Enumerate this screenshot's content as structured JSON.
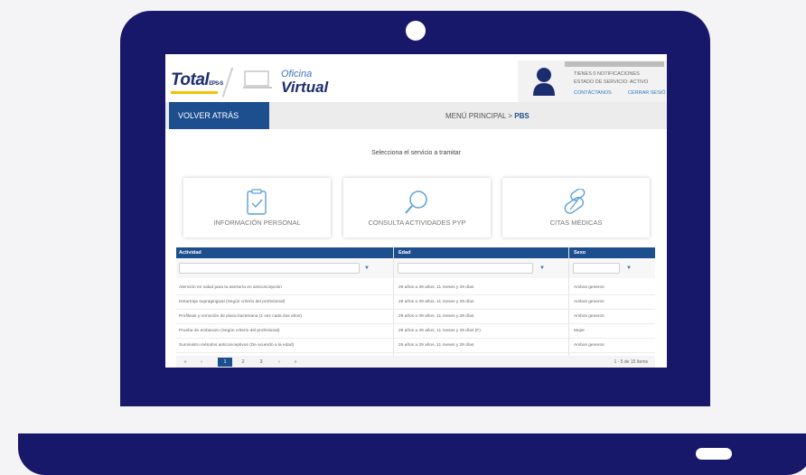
{
  "colors": {
    "laptop": "#18186b",
    "primary": "#1d4f8f",
    "accent": "#f2c200",
    "link": "#2c79c1"
  },
  "logo": {
    "brand": "Total",
    "brand_suffix": "EPS-S",
    "oficina": "Oficina",
    "virtual": "Virtual"
  },
  "user_panel": {
    "avatar_icon": "user-icon",
    "line1": "TIENES  0  NOTIFICACIONES",
    "line2": "ESTADO DE SERVICIO: ACTIVO",
    "contact_link": "CONTÁCTANOS",
    "logout_link": "CERRAR SESIÓ"
  },
  "nav": {
    "back_label": "VOLVER ATRÁS",
    "breadcrumb_prefix": "MENÚ PRINCIPAL > ",
    "breadcrumb_current": "PBS"
  },
  "prompt": "Selecciona el servicio a tramitar",
  "cards": [
    {
      "label": "INFORMACIÓN PERSONAL",
      "icon": "checklist-icon"
    },
    {
      "label": "CONSULTA ACTIVIDADES PYP",
      "icon": "search-icon"
    },
    {
      "label": "CITAS MÉDICAS",
      "icon": "pills-icon"
    }
  ],
  "table": {
    "headers": [
      "Actividad",
      "Edad",
      "Sexo"
    ],
    "filter_icon": "filter-icon",
    "rows": [
      [
        "Atención en salud para la asesoría en anticoncepción",
        "29 años a 39 años, 11 meses y 29 días",
        "Ambos generos"
      ],
      [
        "Detartraje supragingival (Según criterio del profesional)",
        "29 años a 39 años, 11 meses y 29 días",
        "Ambos generos"
      ],
      [
        "Profilaxis y remoción de placa bacteriana (1 vez cada dos años)",
        "29 años a 39 años, 11 meses y 29 días",
        "Ambos generos"
      ],
      [
        "Prueba de embarazo (Según criterio del profesional)",
        "29 años a 49 años, 11 meses y 29 días (F)",
        "Mujer"
      ],
      [
        "Suministro métodos anticonceptivos (De acuerdo a la edad)",
        "29 años a 39 años, 11 meses y 29 días",
        "Ambos generos"
      ]
    ]
  },
  "pager": {
    "first": "«",
    "prev": "‹",
    "pages": [
      "1",
      "2",
      "3"
    ],
    "next": "›",
    "last": "»",
    "info": "1 - 5 de 15 ítems"
  }
}
